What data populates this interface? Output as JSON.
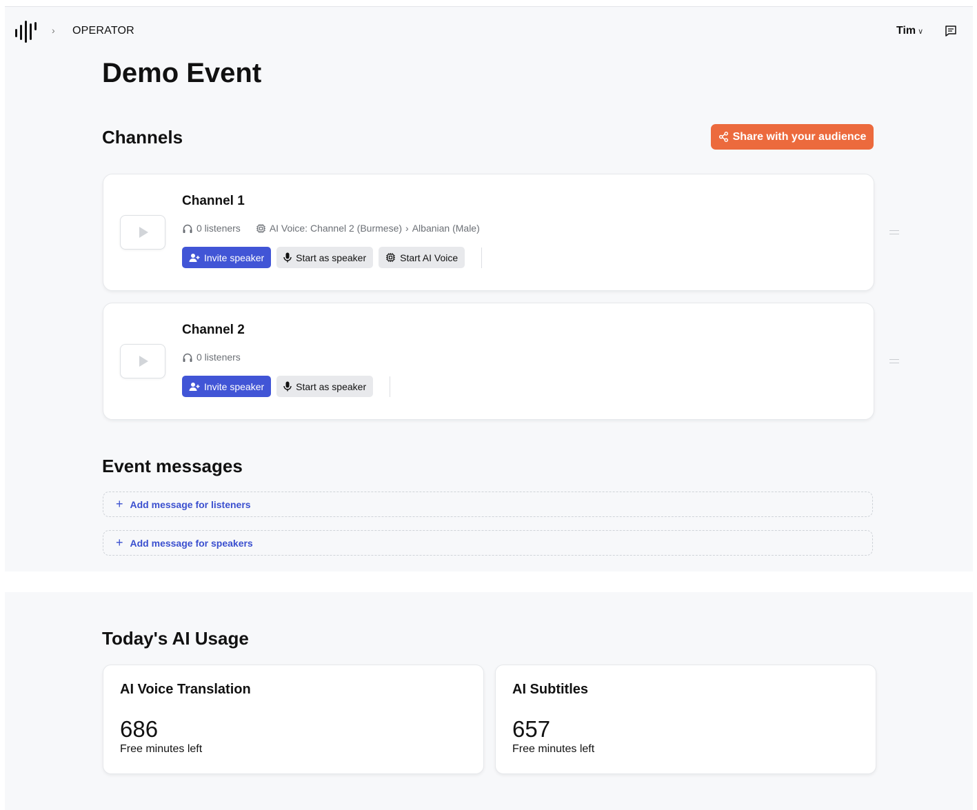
{
  "header": {
    "breadcrumb": "OPERATOR",
    "user_name": "Tim"
  },
  "event": {
    "title": "Demo Event"
  },
  "channels_section": {
    "title": "Channels",
    "share_label": "Share with your audience",
    "channels": [
      {
        "name": "Channel 1",
        "listeners": "0 listeners",
        "ai_voice": "AI Voice: Channel 2 (Burmese)",
        "ai_voice_target": "Albanian (Male)",
        "invite_label": "Invite speaker",
        "start_speaker_label": "Start as speaker",
        "start_ai_label": "Start AI Voice"
      },
      {
        "name": "Channel 2",
        "listeners": "0 listeners",
        "invite_label": "Invite speaker",
        "start_speaker_label": "Start as speaker"
      }
    ]
  },
  "messages_section": {
    "title": "Event messages",
    "add_listeners_label": "Add message for listeners",
    "add_speakers_label": "Add message for speakers"
  },
  "usage_section": {
    "title": "Today's AI Usage",
    "cards": [
      {
        "title": "AI Voice Translation",
        "value": "686",
        "caption": "Free minutes left"
      },
      {
        "title": "AI Subtitles",
        "value": "657",
        "caption": "Free minutes left"
      }
    ]
  },
  "colors": {
    "accent_orange": "#ec6a3d",
    "primary_blue": "#4155d6",
    "link_blue": "#3a4fcf"
  },
  "icons": [
    "logo-bars-icon",
    "chevron-right-icon",
    "chevron-down-icon",
    "chat-icon",
    "share-icon",
    "play-icon",
    "headphones-icon",
    "chip-icon",
    "add-user-icon",
    "microphone-icon",
    "drag-handle-icon",
    "plus-icon"
  ]
}
